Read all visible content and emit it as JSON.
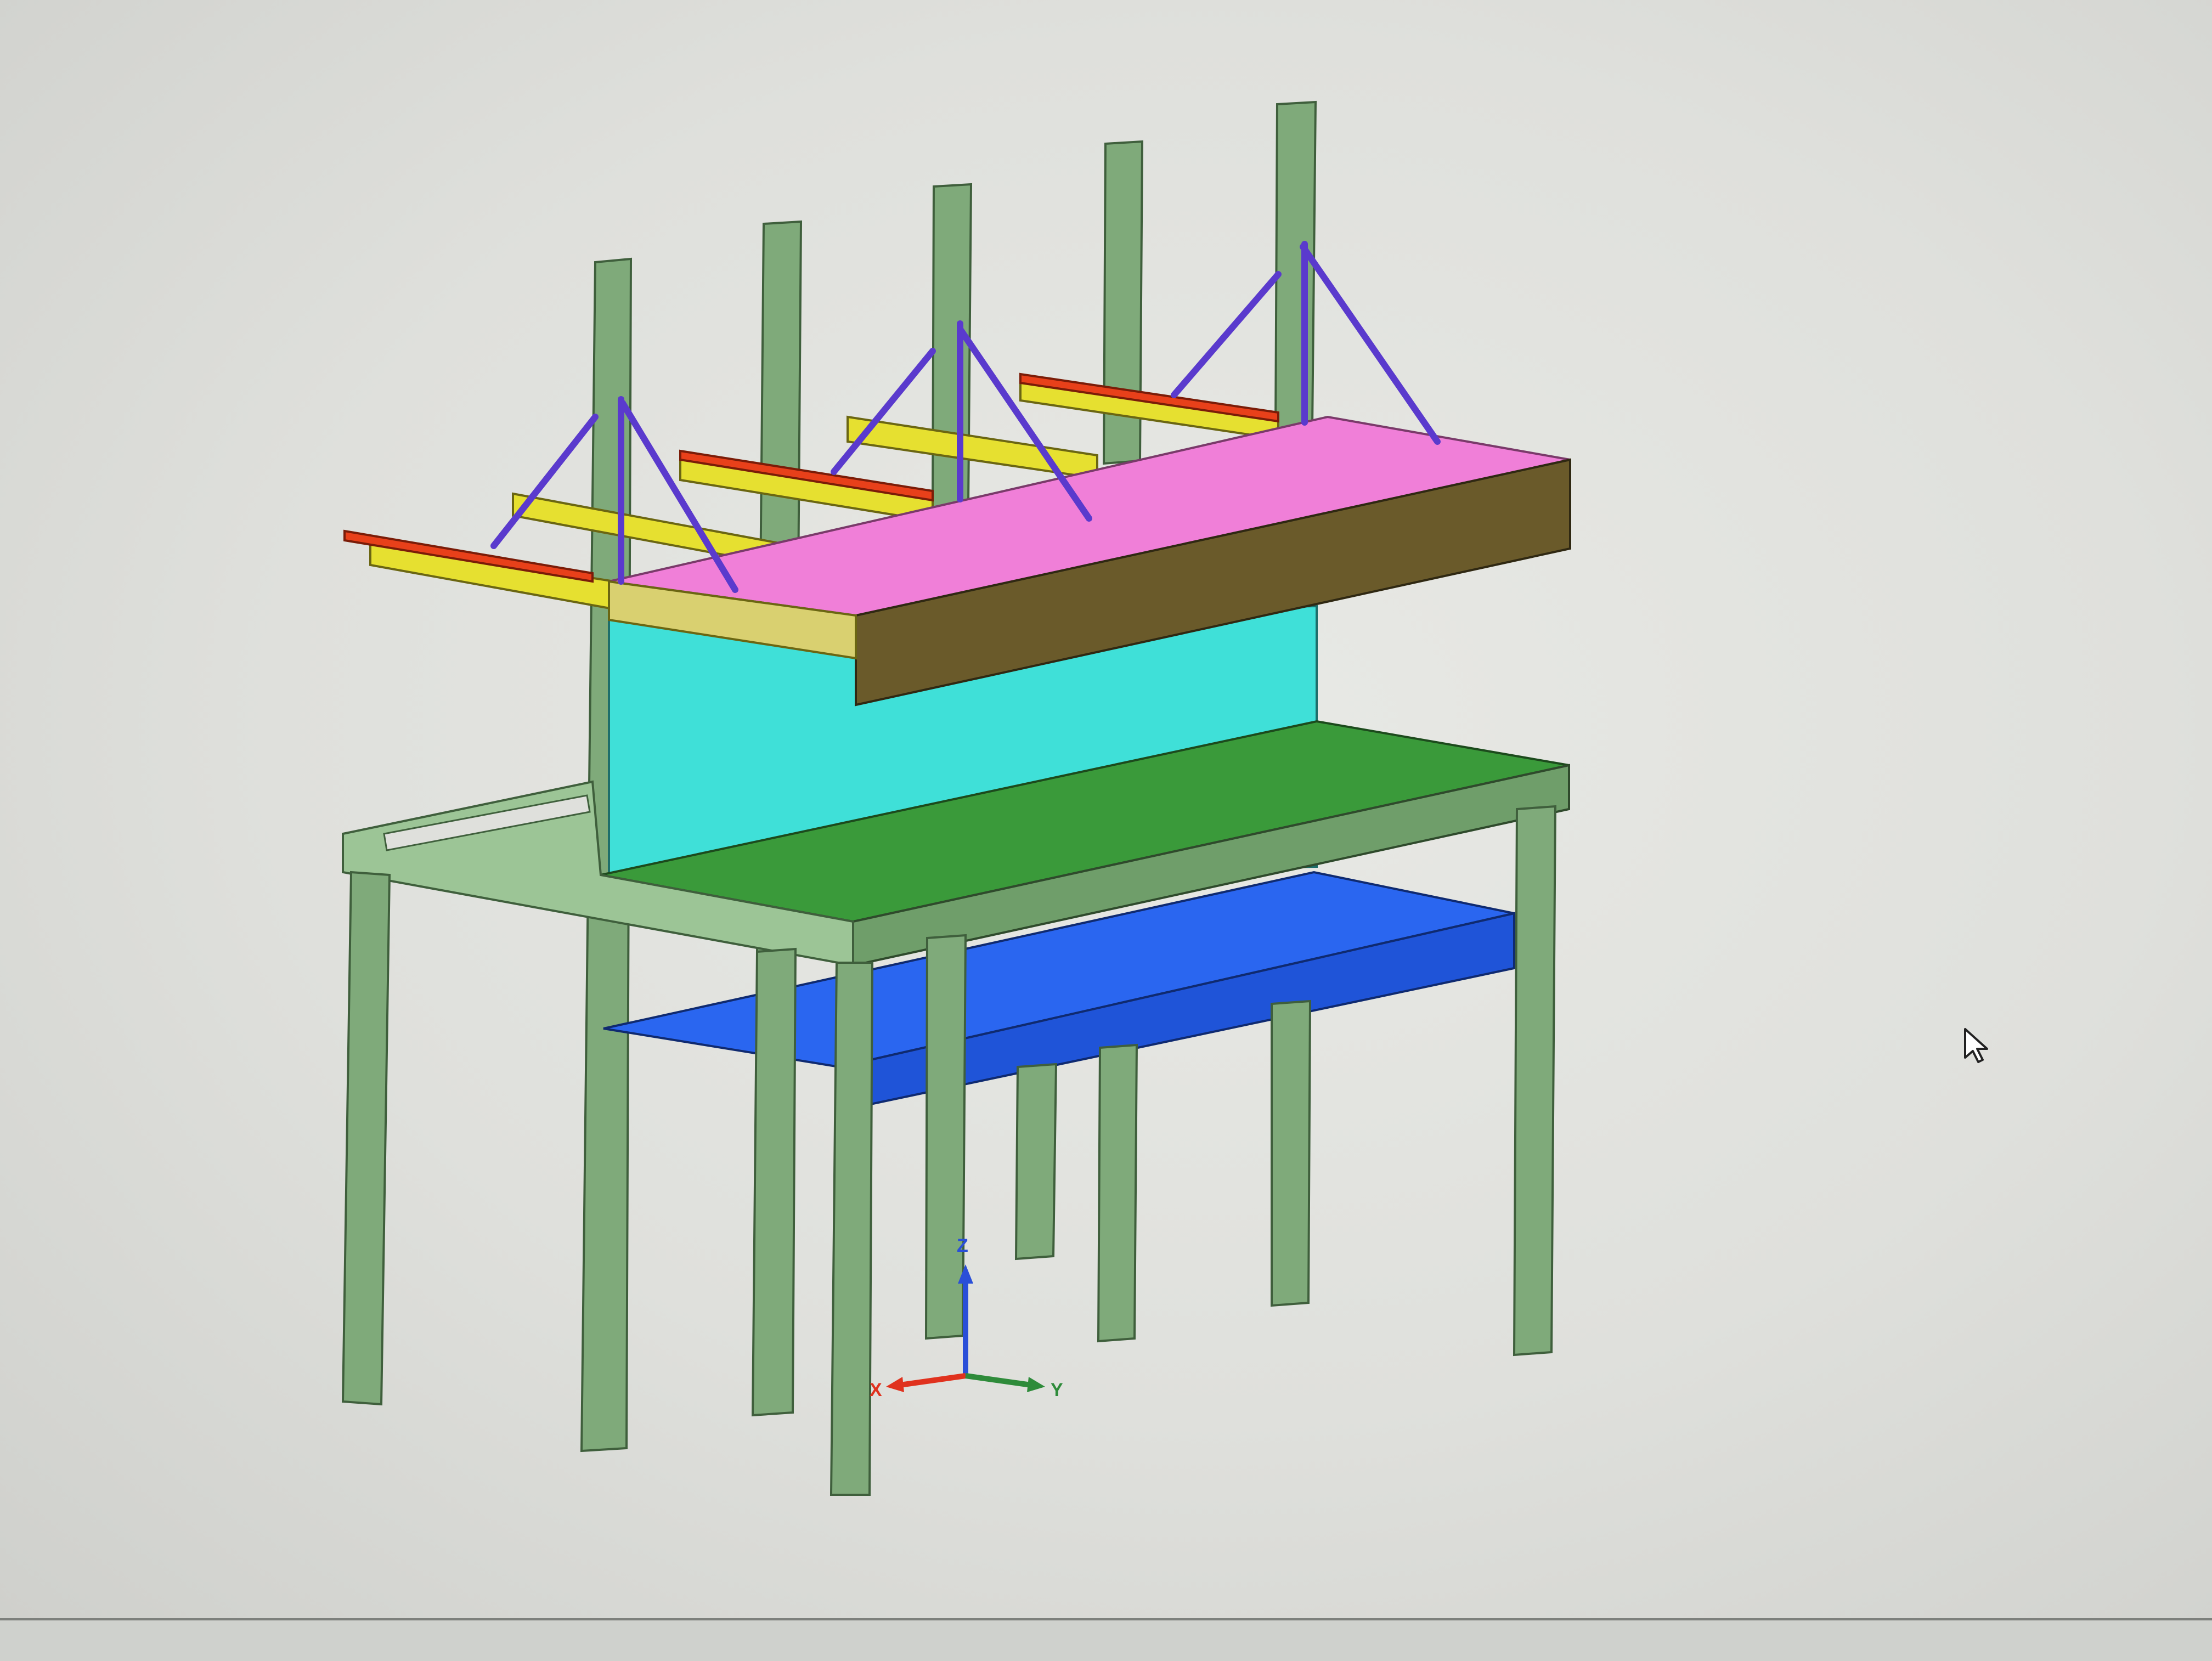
{
  "viewport": {
    "axis_triad": {
      "x_label": "X",
      "y_label": "Y",
      "z_label": "Z",
      "x_color": "#e0321e",
      "y_color": "#2e8b3a",
      "z_color": "#2a4fd8"
    }
  },
  "model": {
    "colors": {
      "frame": "#8fb88a",
      "frame_dark": "#5d8a58",
      "top_shelf": "#f07fd8",
      "top_shelf_front": "#6a5a2a",
      "back_panel": "#3fe0d8",
      "work_surface": "#3a9a3a",
      "lower_shelf": "#2a66f0",
      "beams": "#e6e030",
      "rails": "#e8401a",
      "braces": "#5a3acd"
    }
  }
}
